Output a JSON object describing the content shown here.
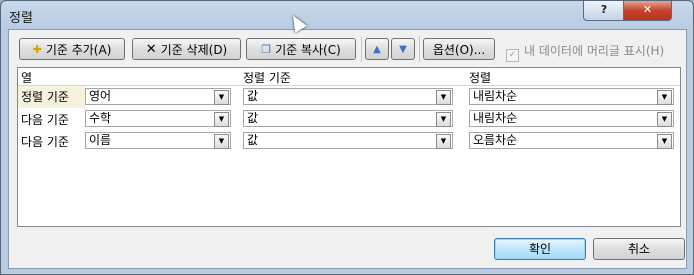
{
  "window": {
    "title": "정렬",
    "help_label": "?",
    "close_label": "✕"
  },
  "toolbar": {
    "add_label": "기준 추가(A)",
    "delete_label": "기준 삭제(D)",
    "copy_label": "기준 복사(C)",
    "move_up_label": "▲",
    "move_down_label": "▼",
    "options_label": "옵션(O)...",
    "header_checkbox_label": "내 데이터에 머리글 표시(H)",
    "header_checkbox_checked": true
  },
  "grid": {
    "columns": [
      "열",
      "정렬 기준",
      "정렬"
    ],
    "rows": [
      {
        "label": "정렬 기준",
        "column": "영어",
        "sort_on": "값",
        "order": "내림차순"
      },
      {
        "label": "다음 기준",
        "column": "수학",
        "sort_on": "값",
        "order": "내림차순"
      },
      {
        "label": "다음 기준",
        "column": "이름",
        "sort_on": "값",
        "order": "오름차순"
      }
    ]
  },
  "footer": {
    "ok_label": "확인",
    "cancel_label": "취소"
  },
  "icons": {
    "add": "add-level-icon",
    "delete": "delete-x-icon",
    "copy": "copy-level-icon",
    "dropdown": "chevron-down-icon"
  }
}
